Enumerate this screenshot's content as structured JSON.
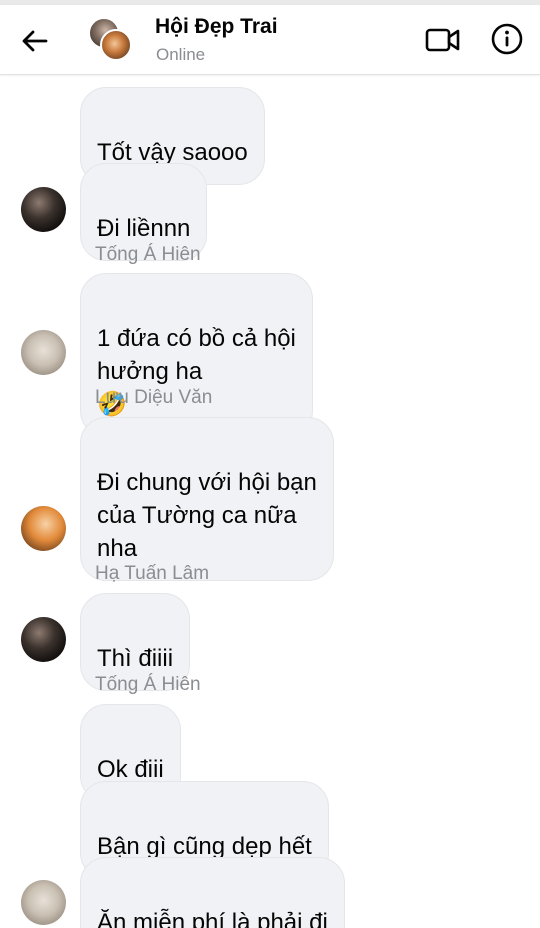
{
  "header": {
    "title": "Hội Đẹp Trai",
    "status": "Online"
  },
  "messages": [
    {
      "text": "Tốt vậy saooo"
    },
    {
      "text": "Đi liềnnn"
    },
    {
      "sender": "Tống Á Hiên",
      "text": "1 đứa có bồ cả hội\nhưởng ha",
      "emoji": "🤣"
    },
    {
      "sender": "Lưu Diệu Văn",
      "text": "Đi chung với hội bạn\ncủa Tường ca nữa\nnha"
    },
    {
      "sender": "Hạ Tuấn Lâm",
      "text": "Thì điiii"
    },
    {
      "sender": "Tống Á Hiên",
      "text": "Ok điii"
    },
    {
      "text": "Bận gì cũng dẹp hết"
    },
    {
      "text": "Ăn miễn phí là phải đi"
    }
  ],
  "colors": {
    "bubble": "#f0f2f5",
    "secondary_text": "#8a8d91"
  },
  "icons": [
    "back-arrow-icon",
    "video-call-icon",
    "info-icon"
  ]
}
